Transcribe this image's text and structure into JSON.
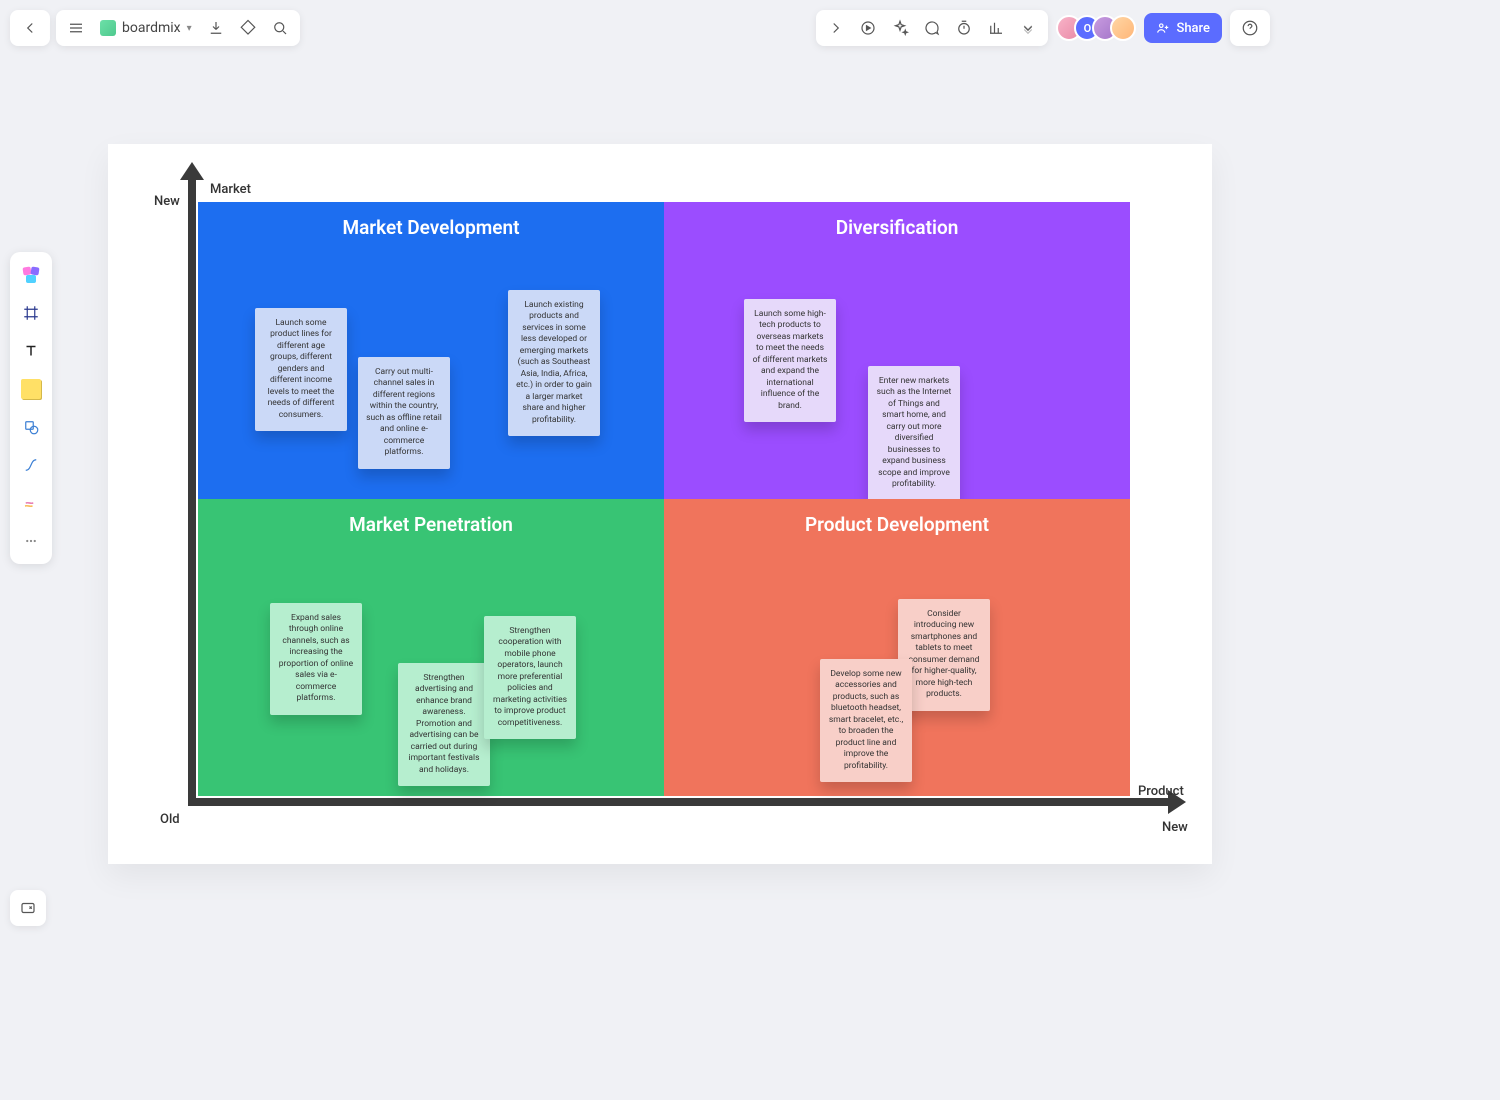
{
  "brand": "boardmix",
  "share_label": "Share",
  "avatar_initial": "O",
  "axis": {
    "y_label": "Market",
    "y_new": "New",
    "x_old": "Old",
    "x_label": "Product",
    "x_new": "New"
  },
  "quadrants": {
    "tl": {
      "title": "Market Development",
      "notes": [
        "Launch some product lines for different age groups, different genders and different income levels to meet the needs of different consumers.",
        "Carry out multi-channel sales in different regions within the country, such as offline retail and online e-commerce platforms.",
        "Launch existing products and services in some less developed or emerging markets (such as Southeast Asia, India, Africa, etc.) in order to gain a larger market share and higher profitability."
      ]
    },
    "tr": {
      "title": "Diversification",
      "notes": [
        "Launch some high-tech products to overseas markets to meet the needs of different markets and expand the international influence of the brand.",
        "Enter new markets such as the Internet of Things and smart home, and carry out more diversified businesses to expand business scope and improve profitability."
      ]
    },
    "bl": {
      "title": "Market Penetration",
      "notes": [
        "Expand sales through online channels, such as increasing the proportion of online sales via e-commerce platforms.",
        "Strengthen advertising and enhance brand awareness. Promotion and advertising can be carried out during important festivals and holidays.",
        "Strengthen cooperation with mobile phone operators, launch more preferential policies and marketing activities to improve product competitiveness."
      ]
    },
    "br": {
      "title": "Product Development",
      "notes": [
        "Consider introducing new smartphones and tablets to meet consumer demand for higher-quality, more high-tech products.",
        "Develop some new accessories and products, such as bluetooth headset, smart bracelet, etc., to broaden the product line and improve the profitability."
      ]
    }
  }
}
